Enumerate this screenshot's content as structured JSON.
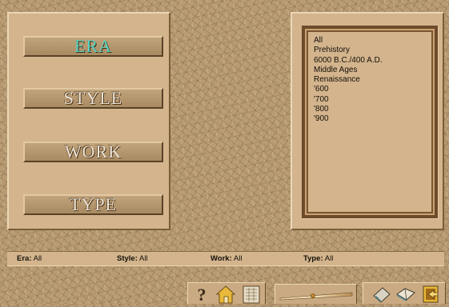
{
  "categories": [
    {
      "label": "ERA",
      "active": true
    },
    {
      "label": "STYLE",
      "active": false
    },
    {
      "label": "WORK",
      "active": false
    },
    {
      "label": "TYPE",
      "active": false
    }
  ],
  "era_list": [
    "All",
    "Prehistory",
    "6000 B.C./400 A.D.",
    "Middle Ages",
    "Renaissance",
    "'600",
    "'700",
    "'800",
    "'900"
  ],
  "status": {
    "era_label": "Era:",
    "era_value": "All",
    "style_label": "Style:",
    "style_value": "All",
    "work_label": "Work:",
    "work_value": "All",
    "type_label": "Type:",
    "type_value": "All"
  },
  "toolbar": {
    "help_icon": "question-mark-icon",
    "home_icon": "home-icon",
    "map_icon": "map-icon",
    "book_icon": "book-icon",
    "open_book_icon": "open-book-icon",
    "exit_icon": "exit-icon",
    "help_glyph": "?"
  },
  "colors": {
    "active_label": "#59d2c2",
    "inactive_label": "#efe6d8",
    "panel": "#d3b48d",
    "frame": "#6e4a2a"
  }
}
